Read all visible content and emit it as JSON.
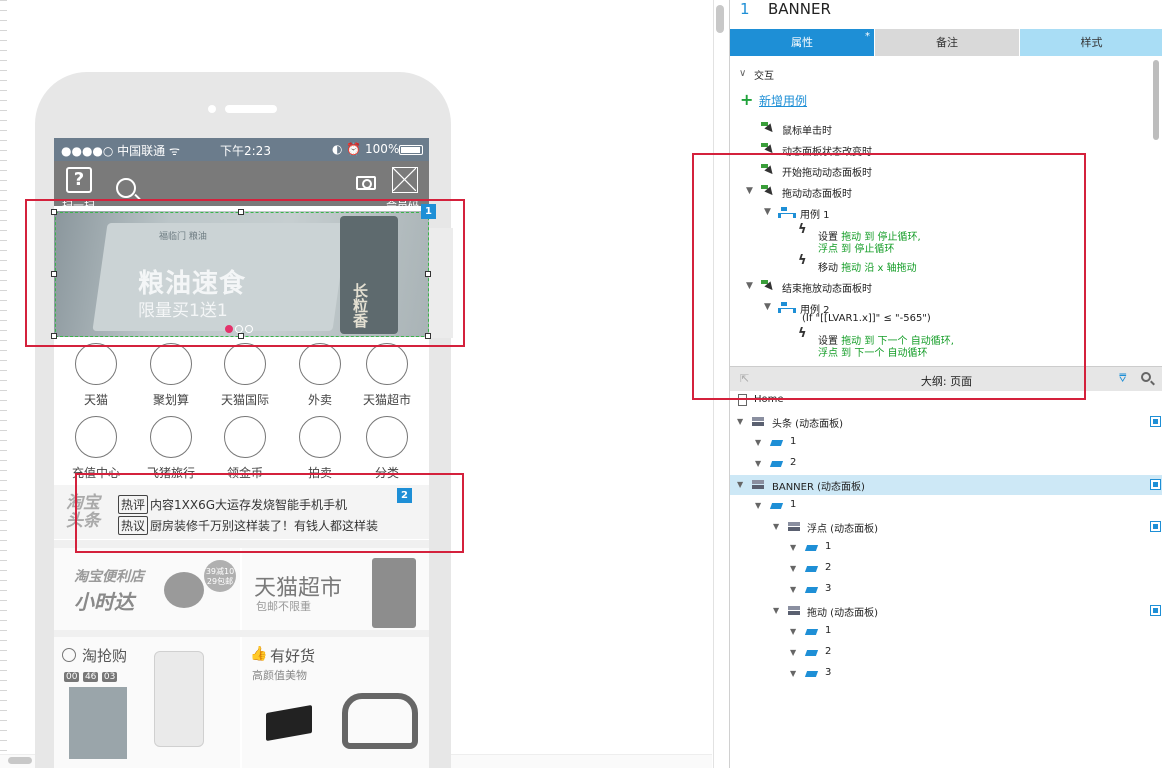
{
  "phone": {
    "status": {
      "carrier": "●●●●○ 中国联通 ᯤ",
      "time": "下午2:23",
      "right": "◐ ⏰ 100%"
    },
    "topbar": {
      "help_glyph": "?",
      "scan_label": "扫一扫",
      "member_label": "会员码"
    },
    "banner": {
      "logo": "福临门 粮油",
      "title": "粮油速食",
      "subtitle": "限量买1送1",
      "product_text": "长粒香",
      "badge": "1"
    },
    "categories_row1": [
      "天猫",
      "聚划算",
      "天猫国际",
      "外卖",
      "天猫超市"
    ],
    "categories_row2": [
      "充值中心",
      "飞猪旅行",
      "领金币",
      "拍卖",
      "分类"
    ],
    "news": {
      "logo_line1": "淘宝",
      "logo_line2": "头条",
      "items": [
        {
          "tag": "热评",
          "text": "内容1XX6G大运存发烧智能手机手机"
        },
        {
          "tag": "热议",
          "text": "厨房装修千万别这样装了！有钱人都这样装"
        }
      ],
      "badge": "2"
    },
    "promo": {
      "left_line1": "淘宝便利店",
      "left_line2": "小时达",
      "badge_line1": "39减10",
      "badge_line2": "29包邮",
      "right_title": "天猫超市",
      "right_sub": "包邮不限重"
    },
    "deal": {
      "left_title": "淘抢购",
      "timer": [
        "00",
        "46",
        "03"
      ],
      "right_title": "有好货",
      "right_sub": "高颜值美物"
    }
  },
  "panel": {
    "index": "1",
    "title": "BANNER",
    "tabs": {
      "properties": "属性",
      "star": "*",
      "notes": "备注",
      "style": "样式"
    },
    "interactions": {
      "section": "交互",
      "add_case": "新增用例",
      "events": {
        "click": "鼠标单击时",
        "state_change": "动态面板状态改变时",
        "drag_start": "开始拖动动态面板时",
        "dragging": "拖动动态面板时",
        "drag_end": "结束拖放动态面板时"
      },
      "case1": {
        "name": "用例 1",
        "a1_verb": "设置",
        "a1_line1": "拖动 到 停止循环,",
        "a1_line2": "浮点 到 停止循环",
        "a2_verb": "移动",
        "a2_line": "拖动 沿 x 轴拖动"
      },
      "case2": {
        "name": "用例 2",
        "condition": "(If \"[[LVAR1.x]]\" ≤ \"-565\")",
        "a1_verb": "设置",
        "a1_line1": "拖动 到 下一个 自动循环,",
        "a1_line2": "浮点 到 下一个 自动循环"
      }
    },
    "outline": {
      "title": "大纲: 页面",
      "tree": {
        "home": "Home",
        "headline": "头条 (动态面板)",
        "s1": "1",
        "s2": "2",
        "banner": "BANNER (动态面板)",
        "b1": "1",
        "float": "浮点 (动态面板)",
        "f1": "1",
        "f2": "2",
        "f3": "3",
        "drag": "拖动 (动态面板)",
        "d1": "1",
        "d2": "2",
        "d3": "3"
      }
    }
  }
}
